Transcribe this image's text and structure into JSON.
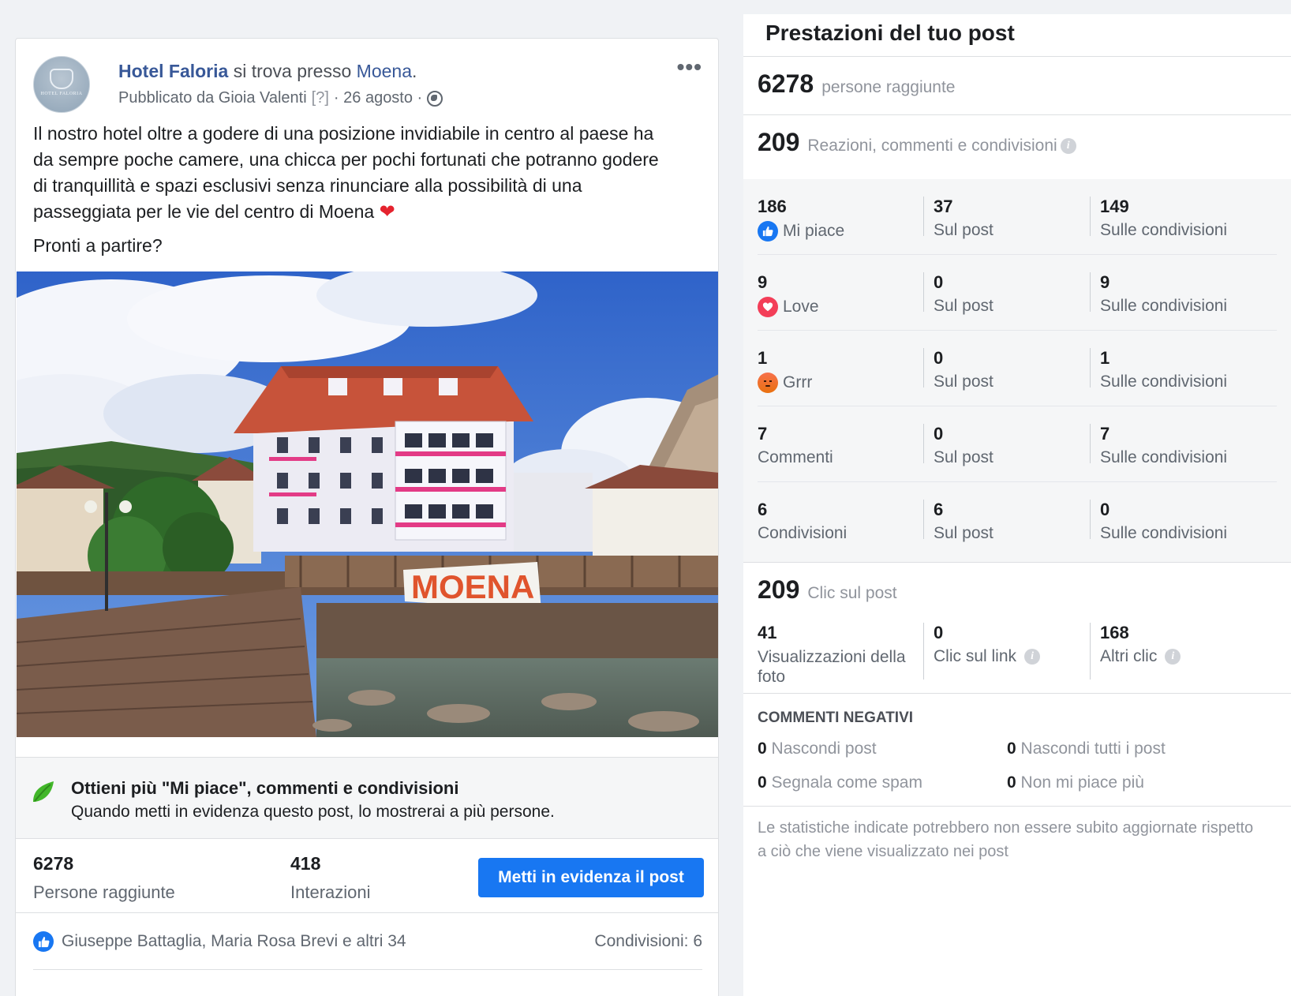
{
  "post": {
    "page_name": "Hotel Faloria",
    "location_prefix": "si trova presso",
    "location": "Moena",
    "location_suffix": ".",
    "published_by": "Pubblicato da Gioia Valenti",
    "help_marker": "[?]",
    "date": "· 26 agosto ·",
    "avatar_text": "HOTEL FALORIA",
    "body_paragraph_1": "Il nostro hotel oltre a godere di una posizione invidiabile in centro al paese ha da sempre poche camere, una chicca per pochi fortunati che potranno godere di tranquillità e spazi esclusivi senza rinunciare alla possibilità di una passeggiata per le vie del centro di Moena",
    "body_paragraph_2": "Pronti a partire?",
    "image_banner_text": "MOENA",
    "promo_title": "Ottieni più \"Mi piace\", commenti e condivisioni",
    "promo_description": "Quando metti in evidenza questo post, lo mostrerai a più persone.",
    "reach_value": "6278",
    "reach_label": "Persone raggiunte",
    "interactions_value": "418",
    "interactions_label": "Interazioni",
    "boost_button_label": "Metti in evidenza il post",
    "likers": "Giuseppe Battaglia, Maria Rosa Brevi e altri 34",
    "shares": "Condivisioni: 6",
    "more_icon": "ellipsis-icon"
  },
  "performance": {
    "title": "Prestazioni del tuo post",
    "reach": {
      "value": "6278",
      "label": "persone raggiunte"
    },
    "engagement": {
      "value": "209",
      "label": "Reazioni, commenti e condivisioni"
    },
    "rows": [
      {
        "total": "186",
        "label": "Mi piace",
        "icon": "like-icon",
        "on_post": "37",
        "on_post_label": "Sul post",
        "on_shares": "149",
        "on_shares_label": "Sulle condivisioni"
      },
      {
        "total": "9",
        "label": "Love",
        "icon": "love-icon",
        "on_post": "0",
        "on_post_label": "Sul post",
        "on_shares": "9",
        "on_shares_label": "Sulle condivisioni"
      },
      {
        "total": "1",
        "label": "Grrr",
        "icon": "angry-icon",
        "on_post": "0",
        "on_post_label": "Sul post",
        "on_shares": "1",
        "on_shares_label": "Sulle condivisioni"
      },
      {
        "total": "7",
        "label": "Commenti",
        "icon": "",
        "on_post": "0",
        "on_post_label": "Sul post",
        "on_shares": "7",
        "on_shares_label": "Sulle condivisioni"
      },
      {
        "total": "6",
        "label": "Condivisioni",
        "icon": "",
        "on_post": "6",
        "on_post_label": "Sul post",
        "on_shares": "0",
        "on_shares_label": "Sulle condivisioni"
      }
    ],
    "clicks": {
      "value": "209",
      "label": "Clic sul post",
      "photo_views": "41",
      "photo_views_label": "Visualizzazioni della foto",
      "link_clicks": "0",
      "link_clicks_label": "Clic sul link",
      "other_clicks": "168",
      "other_clicks_label": "Altri clic"
    },
    "negative": {
      "title": "COMMENTI NEGATIVI",
      "hide_post": {
        "value": "0",
        "label": "Nascondi post"
      },
      "hide_all": {
        "value": "0",
        "label": "Nascondi tutti i post"
      },
      "report_spam": {
        "value": "0",
        "label": "Segnala come spam"
      },
      "unlike": {
        "value": "0",
        "label": "Non mi piace più"
      }
    },
    "footnote": "Le statistiche indicate potrebbero non essere subito aggiornate rispetto a ciò che viene visualizzato nei post"
  },
  "colors": {
    "brand_blue": "#1877f2",
    "link_blue": "#385898",
    "love_red": "#f33e58",
    "angry_orange": "#e9710f",
    "page_bg": "#f0f2f5"
  }
}
